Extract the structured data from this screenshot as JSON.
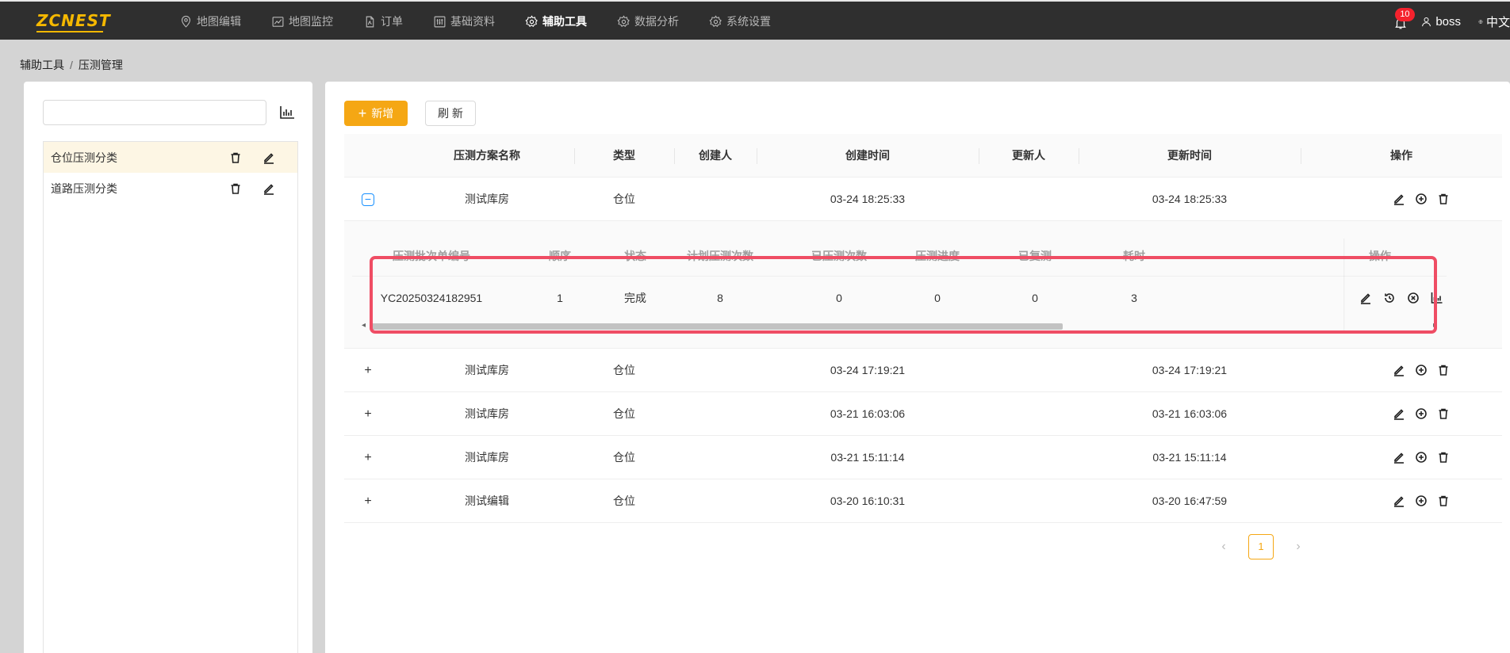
{
  "app": {
    "logo_text": "ZCNEST",
    "brand_color": "#f5a714"
  },
  "nav": {
    "items": [
      {
        "label": "地图编辑",
        "icon": "map-pin-icon"
      },
      {
        "label": "地图监控",
        "icon": "line-chart-icon"
      },
      {
        "label": "订单",
        "icon": "document-icon"
      },
      {
        "label": "基础资料",
        "icon": "sliders-icon"
      },
      {
        "label": "辅助工具",
        "icon": "gear-icon",
        "active": true
      },
      {
        "label": "数据分析",
        "icon": "gear-icon"
      },
      {
        "label": "系统设置",
        "icon": "gear-icon"
      }
    ],
    "notification_count": "10",
    "username": "boss",
    "language": "中文"
  },
  "breadcrumb": {
    "parent": "辅助工具",
    "separator": "/",
    "current": "压测管理"
  },
  "left": {
    "search_value": "",
    "categories": [
      {
        "label": "仓位压测分类",
        "selected": true
      },
      {
        "label": "道路压测分类",
        "selected": false
      }
    ]
  },
  "toolbar": {
    "add_label": "新增",
    "refresh_label": "刷 新"
  },
  "table": {
    "columns": [
      "压测方案名称",
      "类型",
      "创建人",
      "创建时间",
      "更新人",
      "更新时间",
      "操作"
    ],
    "rows": [
      {
        "name": "测试库房",
        "type": "仓位",
        "creator": "",
        "created": "03-24 18:25:33",
        "updater": "",
        "updated": "03-24 18:25:33",
        "expanded": true
      },
      {
        "name": "测试库房",
        "type": "仓位",
        "creator": "",
        "created": "03-24 17:19:21",
        "updater": "",
        "updated": "03-24 17:19:21",
        "expanded": false
      },
      {
        "name": "测试库房",
        "type": "仓位",
        "creator": "",
        "created": "03-21 16:03:06",
        "updater": "",
        "updated": "03-21 16:03:06",
        "expanded": false
      },
      {
        "name": "测试库房",
        "type": "仓位",
        "creator": "",
        "created": "03-21 15:11:14",
        "updater": "",
        "updated": "03-21 15:11:14",
        "expanded": false
      },
      {
        "name": "测试编辑",
        "type": "仓位",
        "creator": "",
        "created": "03-20 16:10:31",
        "updater": "",
        "updated": "03-20 16:47:59",
        "expanded": false
      }
    ]
  },
  "sub_table": {
    "columns": [
      "压测批次单编号",
      "顺序",
      "状态",
      "计划压测次数",
      "已压测次数",
      "压测进度",
      "已复测",
      "耗时",
      "操作"
    ],
    "rows": [
      {
        "batch_no": "YC20250324182951",
        "order": "1",
        "status": "完成",
        "planned": "8",
        "done": "0",
        "progress": "0",
        "retested": "0",
        "duration": "3"
      }
    ]
  },
  "pagination": {
    "current_page": "1",
    "prev_icon": "‹",
    "next_icon": "›"
  }
}
